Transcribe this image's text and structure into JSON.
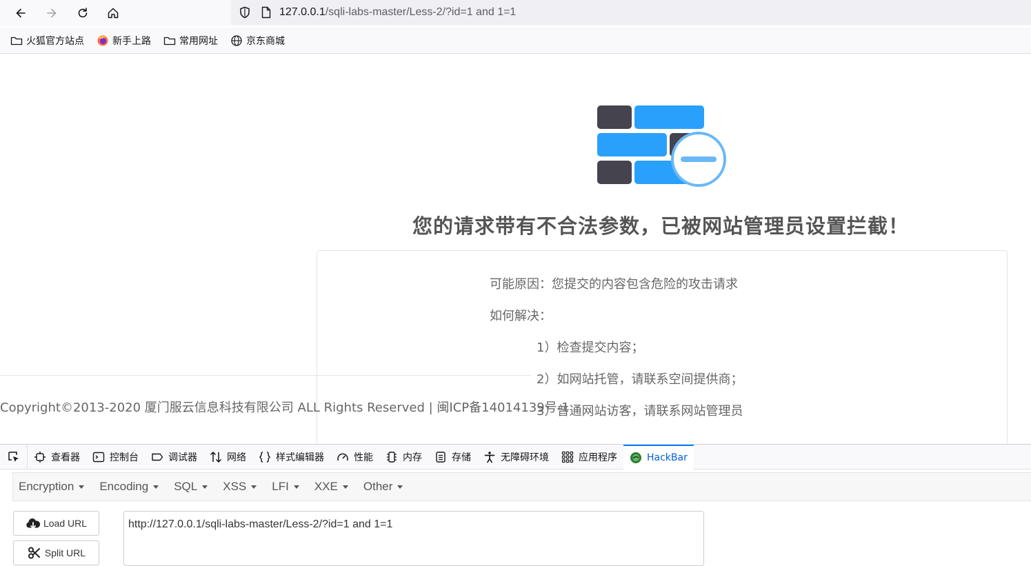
{
  "browser": {
    "url_host": "127.0.0.1",
    "url_path": "/sqli-labs-master/Less-2/?id=1 and 1=1",
    "icons": [
      "back-icon",
      "forward-icon",
      "reload-icon",
      "home-icon",
      "shield-icon",
      "page-icon"
    ]
  },
  "bookmarks": [
    {
      "label": "火狐官方站点",
      "icon": "folder-icon"
    },
    {
      "label": "新手上路",
      "icon": "firefox-icon"
    },
    {
      "label": "常用网址",
      "icon": "folder-icon"
    },
    {
      "label": "京东商城",
      "icon": "globe-icon"
    }
  ],
  "page": {
    "title": "您的请求带有不合法参数，已被网站管理员设置拦截！",
    "reason": "可能原因：您提交的内容包含危险的攻击请求",
    "howto": "如何解决：",
    "steps": [
      "1）检查提交内容；",
      "2）如网站托管，请联系空间提供商；",
      "3）普通网站访客，请联系网站管理员"
    ],
    "copyright": "Copyright©2013-2020 厦门服云信息科技有限公司 ALL Rights Reserved | 闽ICP备14014139号-1",
    "colors": {
      "wall_dark": "#45434e",
      "wall_blue": "#2aa0fd",
      "badge_ring": "#6ab8f7"
    }
  },
  "devtools": {
    "tabs": [
      "查看器",
      "控制台",
      "调试器",
      "网络",
      "样式编辑器",
      "性能",
      "内存",
      "存储",
      "无障碍环境",
      "应用程序",
      "HackBar"
    ],
    "active_tab": "HackBar"
  },
  "hackbar": {
    "menu": [
      "Encryption",
      "Encoding",
      "SQL",
      "XSS",
      "LFI",
      "XXE",
      "Other"
    ],
    "load_url": "Load URL",
    "split_url": "Split URL",
    "url_value": "http://127.0.0.1/sqli-labs-master/Less-2/?id=1 and 1=1"
  }
}
